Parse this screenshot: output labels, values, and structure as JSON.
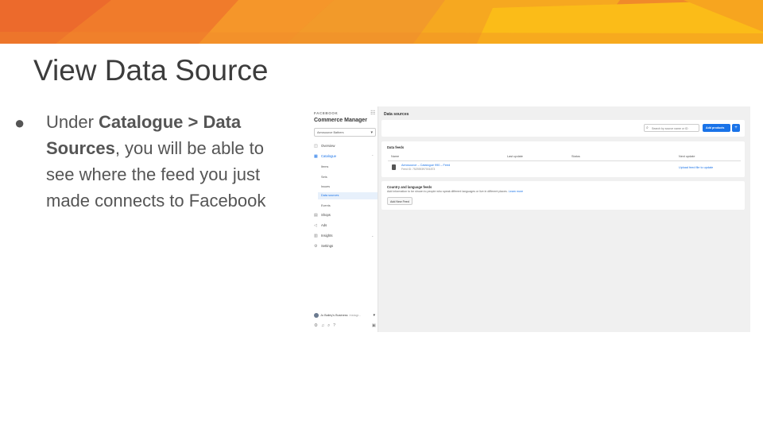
{
  "slide": {
    "title": "View Data Source",
    "bullet": {
      "pre": "Under ",
      "bold1": "Catalogue > Data Sources",
      "post": ", you will be able to see where the feed you just made connects to Facebook"
    }
  },
  "colors": {
    "banner_orange": "#f0822a",
    "banner_yellow": "#fbbc18",
    "banner_red": "#ec6a2c",
    "accent_blue": "#1a73e8"
  },
  "screenshot": {
    "sidebar": {
      "brand": "FACEBOOK",
      "app_name": "Commerce Manager",
      "account": "Aerosource Bathers",
      "nav": [
        {
          "label": "Overview",
          "icon": "overview-icon"
        },
        {
          "label": "Catalogue",
          "icon": "catalogue-icon"
        },
        {
          "label": "Shops",
          "icon": "shop-icon"
        },
        {
          "label": "Ads",
          "icon": "megaphone-icon"
        },
        {
          "label": "Insights",
          "icon": "bar-chart-icon"
        },
        {
          "label": "Settings",
          "icon": "gear-icon"
        }
      ],
      "catalogue_sub": [
        "Items",
        "Sets",
        "Issues",
        "Data sources",
        "Events"
      ],
      "footer_user": "Jo Bailey's Business",
      "footer_user_suffix": "Instagr..."
    },
    "main": {
      "title": "Data sources",
      "search_placeholder": "Search by source name or ID",
      "add_products": "Add products",
      "add_plus": "+",
      "data_feeds": {
        "title": "Data feeds",
        "columns": [
          "Name",
          "Last update",
          "Status",
          "Next update"
        ],
        "row": {
          "name": "Aerosource – Catalogue 990 – Feed",
          "feed_id": "Feed ID: 752939397001873",
          "next_update": "Upload feed file to update"
        }
      },
      "country_feeds": {
        "title": "Country and language feeds",
        "desc": "Add information to be shown to people who speak different languages or live in different places.",
        "learn_more": "Learn more",
        "button": "Add New Feed"
      }
    }
  }
}
